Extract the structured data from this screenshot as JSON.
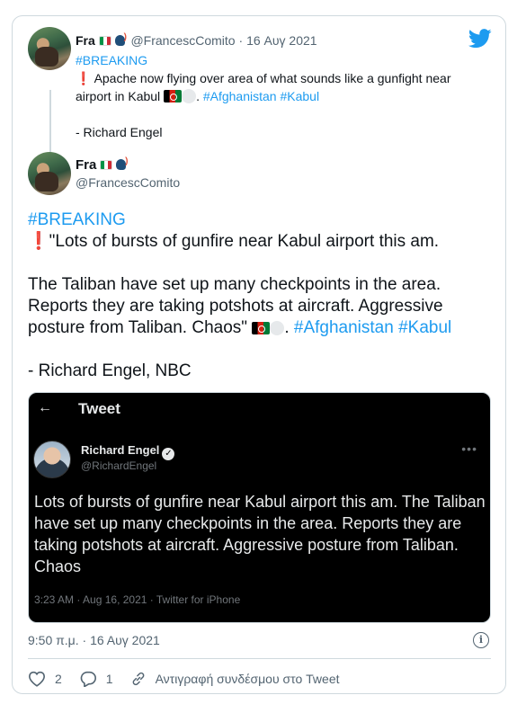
{
  "quoted": {
    "name": "Fra",
    "handle": "@FrancescComito",
    "separator": "·",
    "date": "16 Αυγ 2021",
    "hashtag_breaking": "#BREAKING",
    "line1": "Apache now flying over area of what sounds like a gunfight near",
    "line2_text": "airport in Kabul",
    "hashtag_afghanistan": "#Afghanistan",
    "hashtag_kabul": "#Kabul",
    "signature": "- Richard Engel"
  },
  "main": {
    "name": "Fra",
    "handle": "@FrancescComito",
    "hashtag_breaking": "#BREAKING",
    "line1": "\"Lots of bursts of gunfire near Kabul airport this am.",
    "line2": "The Taliban have set up many checkpoints in the area.",
    "line3": "Reports they are taking potshots at aircraft.  Aggressive",
    "line4_text": "posture from Taliban. Chaos\"",
    "hashtag_afghanistan": "#Afghanistan",
    "hashtag_kabul": "#Kabul",
    "signature": "- Richard Engel, NBC"
  },
  "screenshot": {
    "header_title": "Tweet",
    "author_name": "Richard Engel",
    "author_handle": "@RichardEngel",
    "text": "Lots of bursts of gunfire near Kabul airport this am. The Taliban have set up many checkpoints in the area. Reports they are taking potshots at aircraft. Aggressive posture from Taliban. Chaos",
    "meta": "3:23 AM · Aug 16, 2021 · Twitter for iPhone"
  },
  "footer": {
    "timestamp": "9:50 π.μ. · 16 Αυγ 2021",
    "likes": "2",
    "replies": "1",
    "copy_link_label": "Αντιγραφή συνδέσμου στο Tweet"
  },
  "colors": {
    "link": "#1d9bf0",
    "muted": "#536471",
    "border": "#cfd9de"
  },
  "icons": [
    "twitter-bird-icon",
    "back-arrow-icon",
    "verified-icon",
    "more-icon",
    "info-icon",
    "heart-icon",
    "reply-icon",
    "link-icon",
    "italy-flag-icon",
    "speaking-head-icon",
    "afghanistan-flag-icon",
    "white-circle-icon",
    "exclamation-icon"
  ]
}
